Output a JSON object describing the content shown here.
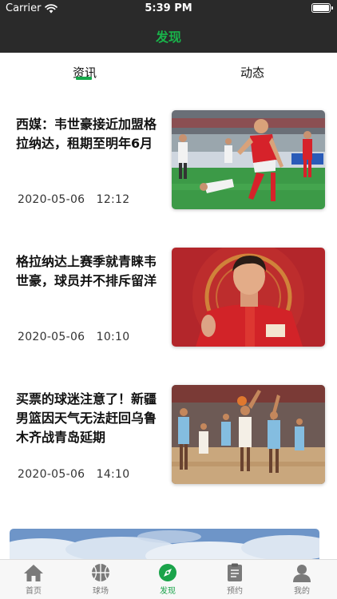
{
  "status_bar": {
    "carrier": "Carrier",
    "time": "5:39 PM"
  },
  "nav": {
    "title": "发现",
    "title_color": "#19b24a"
  },
  "tabs": [
    {
      "label": "资讯",
      "active": true
    },
    {
      "label": "动态",
      "active": false
    }
  ],
  "articles": [
    {
      "title": "西媒：韦世豪接近加盟格拉纳达，租期至明年6月",
      "date": "2020-05-06   12:12",
      "thumbnail": "soccer-player-celebrating-photo"
    },
    {
      "title": "格拉纳达上赛季就青睐韦世豪，球员并不排斥留洋",
      "date": "2020-05-06   10:10",
      "thumbnail": "soccer-player-portrait-photo"
    },
    {
      "title": "买票的球迷注意了！新疆男篮因天气无法赶回乌鲁木齐战青岛延期",
      "date": "2020-05-06   14:10",
      "thumbnail": "basketball-game-photo"
    }
  ],
  "banner": {
    "image": "sky-clouds-banner"
  },
  "tabbar": {
    "items": [
      {
        "label": "首页",
        "icon": "home-icon",
        "active": false
      },
      {
        "label": "球场",
        "icon": "ball-icon",
        "active": false
      },
      {
        "label": "发现",
        "icon": "compass-icon",
        "active": true
      },
      {
        "label": "预约",
        "icon": "clipboard-icon",
        "active": false
      },
      {
        "label": "我的",
        "icon": "person-icon",
        "active": false
      }
    ],
    "active_color": "#1aa34a",
    "inactive_color": "#777777"
  }
}
